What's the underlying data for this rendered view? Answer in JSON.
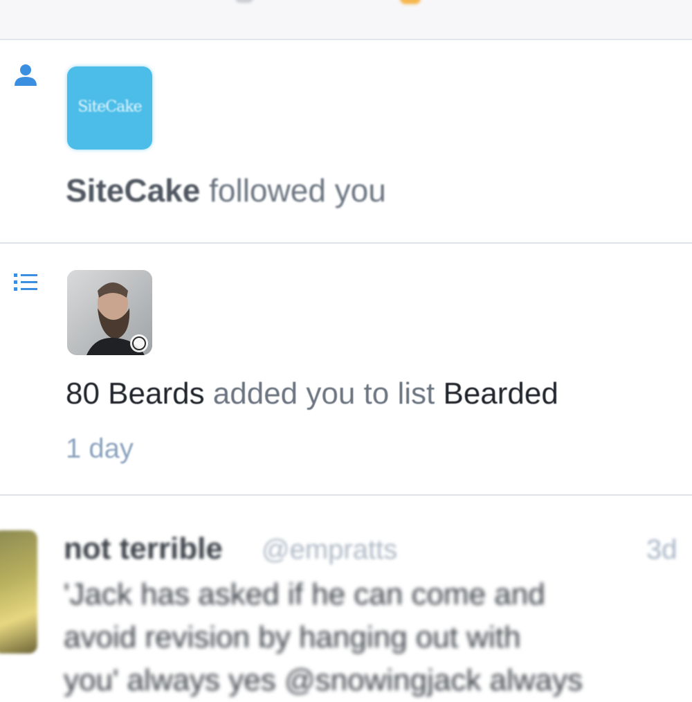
{
  "notifications": [
    {
      "type": "follow",
      "icon": "person-icon",
      "avatar_text": "SiteCake",
      "avatar_color": "#4bbde8",
      "actor": "SiteCake",
      "action": " followed you"
    },
    {
      "type": "list_add",
      "icon": "list-icon",
      "actor": "80 Beards",
      "action": " added you to list ",
      "list_name": "Bearded",
      "time": "1 day"
    }
  ],
  "tweet": {
    "name": "not terrible",
    "handle": "@empratts",
    "time": "3d",
    "text_lines": [
      "'Jack has asked if he can come and",
      "avoid revision by hanging out with",
      "you' always yes @snowingjack always"
    ]
  },
  "colors": {
    "accent_blue": "#3b8fe0",
    "timestamp": "#8aa2bd"
  }
}
